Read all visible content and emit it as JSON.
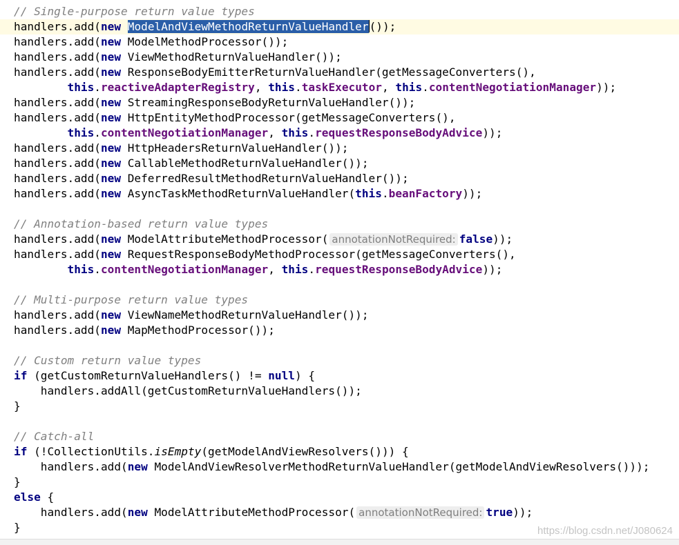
{
  "editor": {
    "colors": {
      "background": "#ffffff",
      "current_line": "#fffbe3",
      "keyword": "#000080",
      "field": "#660e7a",
      "comment": "#808080",
      "selection": "#2a5ea8",
      "param_hint": "#7f7f7f"
    },
    "lines": [
      {
        "tokens": [
          {
            "t": "// Single-purpose return value types",
            "s": "comment"
          }
        ]
      },
      {
        "current": true,
        "tokens": [
          {
            "t": "handlers.add(",
            "s": "plain"
          },
          {
            "t": "new",
            "s": "kw"
          },
          {
            "t": " ",
            "s": "plain"
          },
          {
            "t": "ModelAndViewMethodReturnValueHandler",
            "s": "sel"
          },
          {
            "caret": true
          },
          {
            "t": "());",
            "s": "plain"
          }
        ]
      },
      {
        "tokens": [
          {
            "t": "handlers.add(",
            "s": "plain"
          },
          {
            "t": "new",
            "s": "kw"
          },
          {
            "t": " ModelMethodProcessor());",
            "s": "plain"
          }
        ]
      },
      {
        "tokens": [
          {
            "t": "handlers.add(",
            "s": "plain"
          },
          {
            "t": "new",
            "s": "kw"
          },
          {
            "t": " ViewMethodReturnValueHandler());",
            "s": "plain"
          }
        ]
      },
      {
        "tokens": [
          {
            "t": "handlers.add(",
            "s": "plain"
          },
          {
            "t": "new",
            "s": "kw"
          },
          {
            "t": " ResponseBodyEmitterReturnValueHandler(getMessageConverters(),",
            "s": "plain"
          }
        ]
      },
      {
        "tokens": [
          {
            "t": "        ",
            "s": "plain"
          },
          {
            "t": "this",
            "s": "kw"
          },
          {
            "t": ".",
            "s": "plain"
          },
          {
            "t": "reactiveAdapterRegistry",
            "s": "field"
          },
          {
            "t": ", ",
            "s": "plain"
          },
          {
            "t": "this",
            "s": "kw"
          },
          {
            "t": ".",
            "s": "plain"
          },
          {
            "t": "taskExecutor",
            "s": "field"
          },
          {
            "t": ", ",
            "s": "plain"
          },
          {
            "t": "this",
            "s": "kw"
          },
          {
            "t": ".",
            "s": "plain"
          },
          {
            "t": "contentNegotiationManager",
            "s": "field"
          },
          {
            "t": "));",
            "s": "plain"
          }
        ]
      },
      {
        "tokens": [
          {
            "t": "handlers.add(",
            "s": "plain"
          },
          {
            "t": "new",
            "s": "kw"
          },
          {
            "t": " StreamingResponseBodyReturnValueHandler());",
            "s": "plain"
          }
        ]
      },
      {
        "tokens": [
          {
            "t": "handlers.add(",
            "s": "plain"
          },
          {
            "t": "new",
            "s": "kw"
          },
          {
            "t": " HttpEntityMethodProcessor(getMessageConverters(),",
            "s": "plain"
          }
        ]
      },
      {
        "tokens": [
          {
            "t": "        ",
            "s": "plain"
          },
          {
            "t": "this",
            "s": "kw"
          },
          {
            "t": ".",
            "s": "plain"
          },
          {
            "t": "contentNegotiationManager",
            "s": "field"
          },
          {
            "t": ", ",
            "s": "plain"
          },
          {
            "t": "this",
            "s": "kw"
          },
          {
            "t": ".",
            "s": "plain"
          },
          {
            "t": "requestResponseBodyAdvice",
            "s": "field"
          },
          {
            "t": "));",
            "s": "plain"
          }
        ]
      },
      {
        "tokens": [
          {
            "t": "handlers.add(",
            "s": "plain"
          },
          {
            "t": "new",
            "s": "kw"
          },
          {
            "t": " HttpHeadersReturnValueHandler());",
            "s": "plain"
          }
        ]
      },
      {
        "tokens": [
          {
            "t": "handlers.add(",
            "s": "plain"
          },
          {
            "t": "new",
            "s": "kw"
          },
          {
            "t": " CallableMethodReturnValueHandler());",
            "s": "plain"
          }
        ]
      },
      {
        "tokens": [
          {
            "t": "handlers.add(",
            "s": "plain"
          },
          {
            "t": "new",
            "s": "kw"
          },
          {
            "t": " DeferredResultMethodReturnValueHandler());",
            "s": "plain"
          }
        ]
      },
      {
        "tokens": [
          {
            "t": "handlers.add(",
            "s": "plain"
          },
          {
            "t": "new",
            "s": "kw"
          },
          {
            "t": " AsyncTaskMethodReturnValueHandler(",
            "s": "plain"
          },
          {
            "t": "this",
            "s": "kw"
          },
          {
            "t": ".",
            "s": "plain"
          },
          {
            "t": "beanFactory",
            "s": "field"
          },
          {
            "t": "));",
            "s": "plain"
          }
        ]
      },
      {
        "tokens": []
      },
      {
        "tokens": [
          {
            "t": "// Annotation-based return value types",
            "s": "comment"
          }
        ]
      },
      {
        "tokens": [
          {
            "t": "handlers.add(",
            "s": "plain"
          },
          {
            "t": "new",
            "s": "kw"
          },
          {
            "t": " ModelAttributeMethodProcessor(",
            "s": "plain"
          },
          {
            "t": "annotationNotRequired:",
            "s": "hint"
          },
          {
            "t": "false",
            "s": "kw"
          },
          {
            "t": "));",
            "s": "plain"
          }
        ]
      },
      {
        "tokens": [
          {
            "t": "handlers.add(",
            "s": "plain"
          },
          {
            "t": "new",
            "s": "kw"
          },
          {
            "t": " RequestResponseBodyMethodProcessor(getMessageConverters(),",
            "s": "plain"
          }
        ]
      },
      {
        "tokens": [
          {
            "t": "        ",
            "s": "plain"
          },
          {
            "t": "this",
            "s": "kw"
          },
          {
            "t": ".",
            "s": "plain"
          },
          {
            "t": "contentNegotiationManager",
            "s": "field"
          },
          {
            "t": ", ",
            "s": "plain"
          },
          {
            "t": "this",
            "s": "kw"
          },
          {
            "t": ".",
            "s": "plain"
          },
          {
            "t": "requestResponseBodyAdvice",
            "s": "field"
          },
          {
            "t": "));",
            "s": "plain"
          }
        ]
      },
      {
        "tokens": []
      },
      {
        "tokens": [
          {
            "t": "// Multi-purpose return value types",
            "s": "comment"
          }
        ]
      },
      {
        "tokens": [
          {
            "t": "handlers.add(",
            "s": "plain"
          },
          {
            "t": "new",
            "s": "kw"
          },
          {
            "t": " ViewNameMethodReturnValueHandler());",
            "s": "plain"
          }
        ]
      },
      {
        "tokens": [
          {
            "t": "handlers.add(",
            "s": "plain"
          },
          {
            "t": "new",
            "s": "kw"
          },
          {
            "t": " MapMethodProcessor());",
            "s": "plain"
          }
        ]
      },
      {
        "tokens": []
      },
      {
        "tokens": [
          {
            "t": "// Custom return value types",
            "s": "comment"
          }
        ]
      },
      {
        "tokens": [
          {
            "t": "if",
            "s": "kw"
          },
          {
            "t": " (getCustomReturnValueHandlers() != ",
            "s": "plain"
          },
          {
            "t": "null",
            "s": "kw"
          },
          {
            "t": ") {",
            "s": "plain"
          }
        ]
      },
      {
        "tokens": [
          {
            "t": "    handlers.addAll(getCustomReturnValueHandlers());",
            "s": "plain"
          }
        ]
      },
      {
        "tokens": [
          {
            "t": "}",
            "s": "plain"
          }
        ]
      },
      {
        "tokens": []
      },
      {
        "tokens": [
          {
            "t": "// Catch-all",
            "s": "comment"
          }
        ]
      },
      {
        "tokens": [
          {
            "t": "if",
            "s": "kw"
          },
          {
            "t": " (!CollectionUtils.",
            "s": "plain"
          },
          {
            "t": "isEmpty",
            "s": "italic"
          },
          {
            "t": "(getModelAndViewResolvers())) {",
            "s": "plain"
          }
        ]
      },
      {
        "tokens": [
          {
            "t": "    handlers.add(",
            "s": "plain"
          },
          {
            "t": "new",
            "s": "kw"
          },
          {
            "t": " ModelAndViewResolverMethodReturnValueHandler(getModelAndViewResolvers()));",
            "s": "plain"
          }
        ]
      },
      {
        "tokens": [
          {
            "t": "}",
            "s": "plain"
          }
        ]
      },
      {
        "tokens": [
          {
            "t": "else",
            "s": "kw"
          },
          {
            "t": " {",
            "s": "plain"
          }
        ]
      },
      {
        "tokens": [
          {
            "t": "    handlers.add(",
            "s": "plain"
          },
          {
            "t": "new",
            "s": "kw"
          },
          {
            "t": " ModelAttributeMethodProcessor(",
            "s": "plain"
          },
          {
            "t": "annotationNotRequired:",
            "s": "hint"
          },
          {
            "t": "true",
            "s": "kw"
          },
          {
            "t": "));",
            "s": "plain"
          }
        ]
      },
      {
        "tokens": [
          {
            "t": "}",
            "s": "plain"
          }
        ]
      }
    ]
  },
  "status_strip": {
    "text": ""
  },
  "watermark": {
    "text": "https://blog.csdn.net/J080624"
  }
}
